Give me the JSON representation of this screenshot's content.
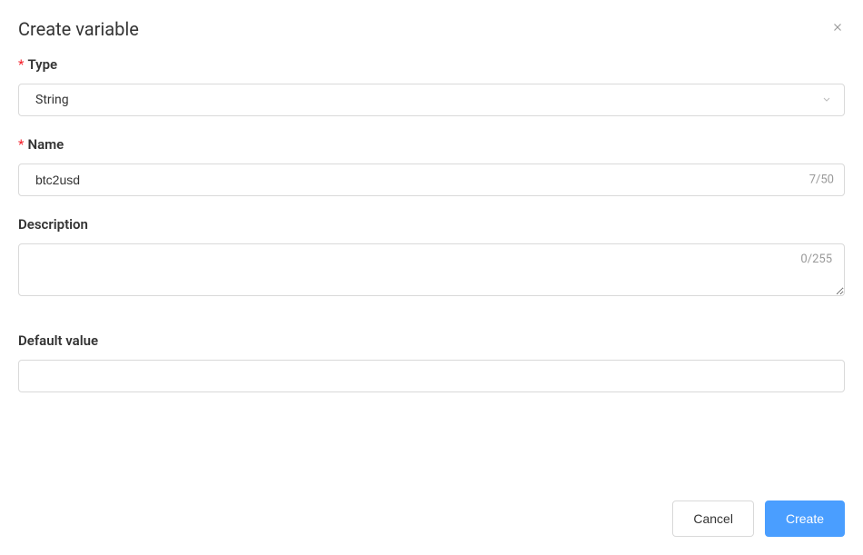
{
  "dialog": {
    "title": "Create variable",
    "fields": {
      "type": {
        "label": "Type",
        "value": "String",
        "required": true
      },
      "name": {
        "label": "Name",
        "value": "btc2usd",
        "counter": "7/50",
        "required": true
      },
      "description": {
        "label": "Description",
        "value": "",
        "counter": "0/255",
        "required": false
      },
      "default_value": {
        "label": "Default value",
        "value": "",
        "required": false
      }
    },
    "buttons": {
      "cancel": "Cancel",
      "create": "Create"
    },
    "required_mark": "*"
  }
}
